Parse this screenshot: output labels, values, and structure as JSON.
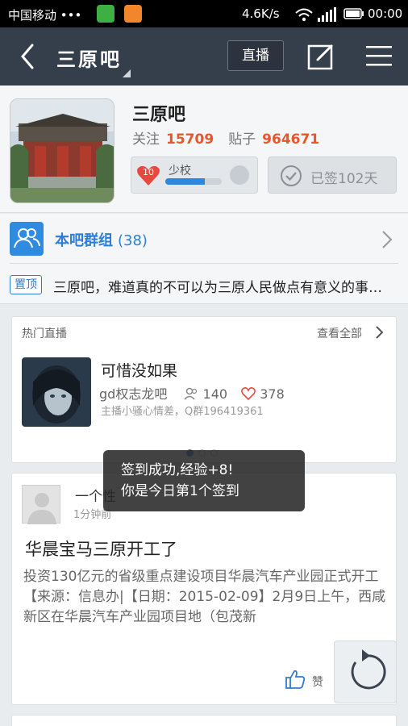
{
  "status_bar": {
    "carrier": "中国移动 •••",
    "speed": "4.6K/s",
    "time": "00:00"
  },
  "nav": {
    "title": "三原吧",
    "live_label": "直播"
  },
  "forum": {
    "name": "三原吧",
    "follow_label": "关注",
    "follow_count": "15709",
    "posts_label": "贴子",
    "posts_count": "964671",
    "level": "10",
    "rank_title": "少校",
    "level_progress": 0.7,
    "signed_text": "已签102天"
  },
  "group": {
    "label": "本吧群组",
    "count": "(38)"
  },
  "pinned": {
    "tag": "置顶",
    "text": "三原吧，难道真的不可以为三原人民做点有意义的事情吗"
  },
  "live": {
    "header": "热门直播",
    "view_all": "查看全部",
    "title": "可惜没如果",
    "forum": "gd权志龙吧",
    "viewers": "140",
    "likes": "378",
    "host": "主播小骚心情差，Q群196419361",
    "page_count": 3,
    "active_page": 1
  },
  "post": {
    "user": "一个性",
    "time": "1分钟前",
    "title": "华晨宝马三原开工了",
    "body": "投资130亿元的省级重点建设项目华晨汽车产业园正式开工【来源：信息办|【日期：2015-02-09】2月9日上午，西咸新区在华晨汽车产业园项目地（包茂新",
    "like_label": "赞"
  },
  "toast": {
    "line1": "签到成功,经验+8!",
    "line2": "你是今日第1个签到"
  },
  "colors": {
    "nav_bg": "#353e4b",
    "accent_blue": "#2e86de",
    "accent_orange": "#e8562b",
    "heart_red": "#e8493f"
  }
}
